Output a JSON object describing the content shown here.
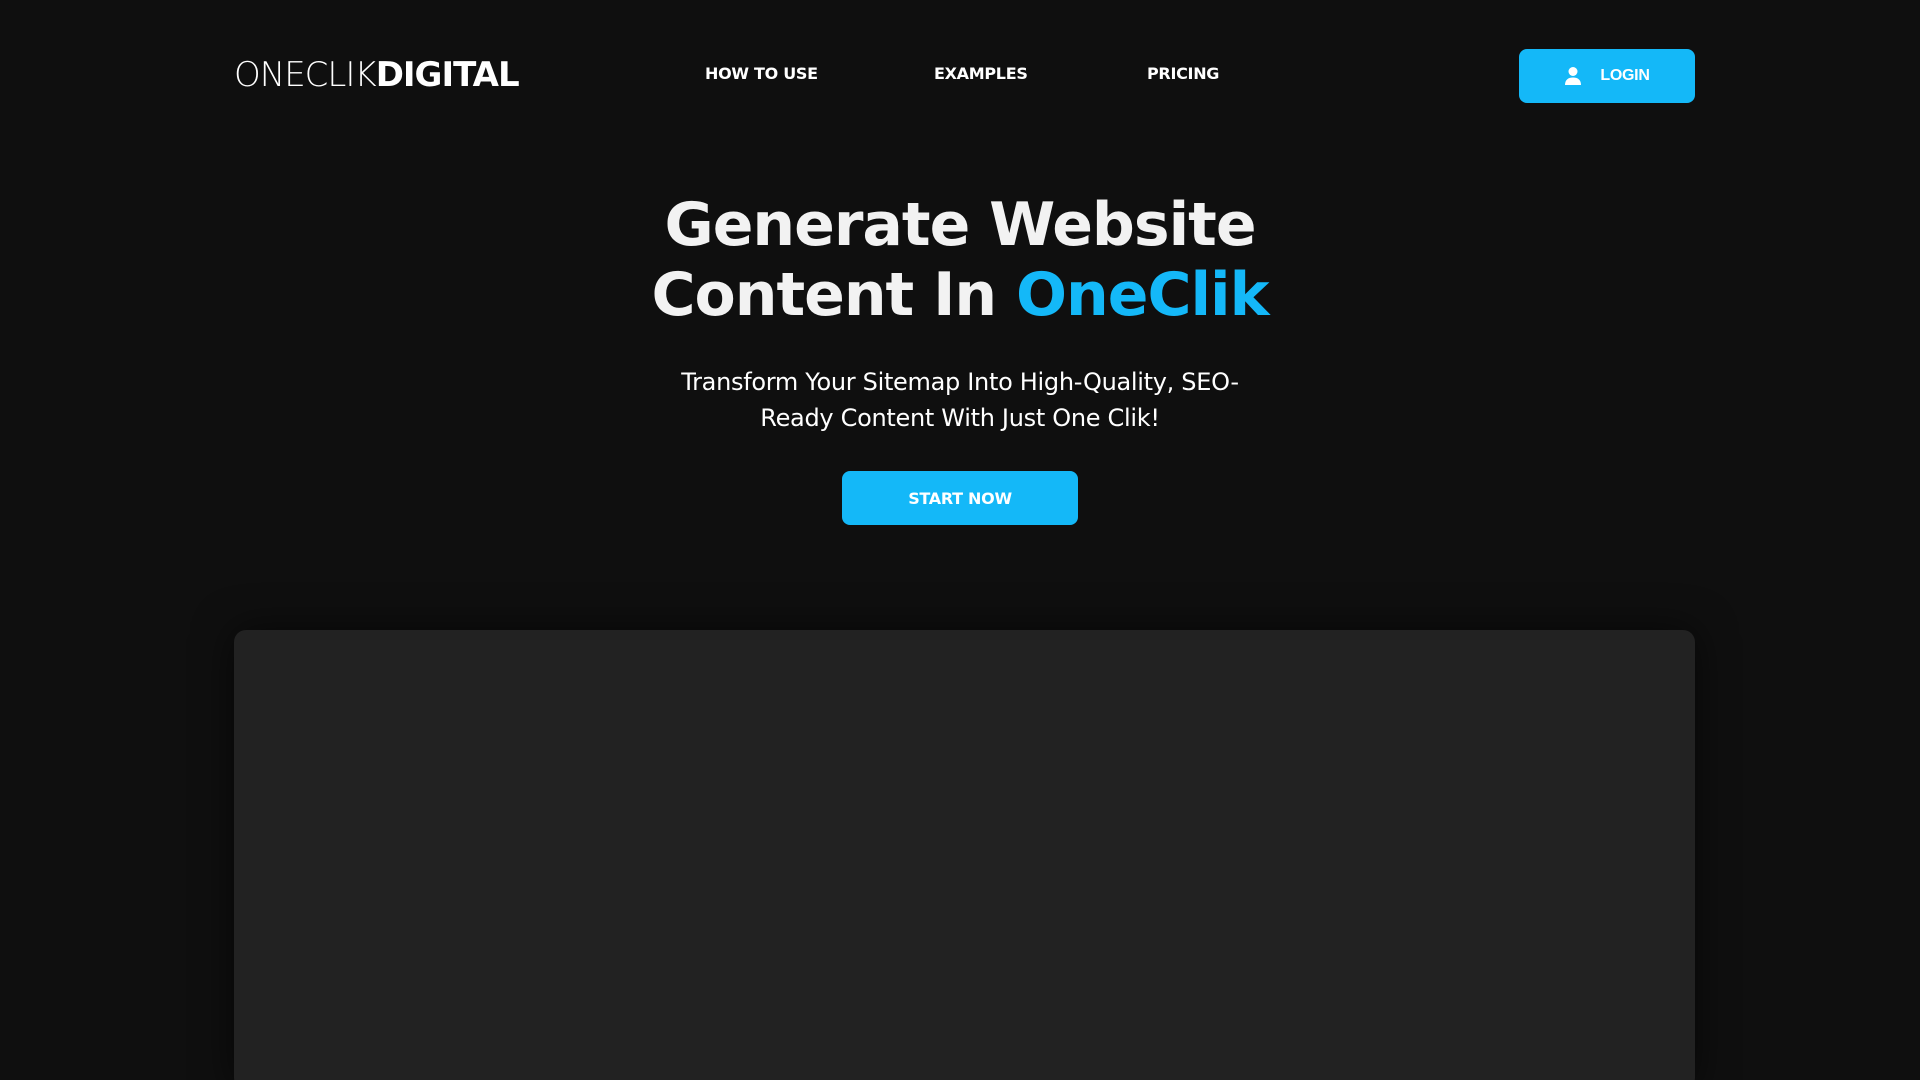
{
  "brand": {
    "logo_light": "ONECLIK",
    "logo_bold": "DIGITAL"
  },
  "nav": {
    "items": [
      {
        "label": "HOW TO USE"
      },
      {
        "label": "EXAMPLES"
      },
      {
        "label": "PRICING"
      }
    ],
    "login_label": "LOGIN",
    "login_icon": "user-icon"
  },
  "hero": {
    "title_line1": "Generate Website",
    "title_line2_prefix": "Content In ",
    "title_line2_accent": "OneClik",
    "subtitle": "Transform Your Sitemap Into High-Quality, SEO-Ready Content With Just One Clik!",
    "cta_label": "START NOW"
  },
  "colors": {
    "background": "#0f0f0f",
    "accent": "#14b8f8",
    "panel": "#222222",
    "text": "#f2f2f2"
  }
}
